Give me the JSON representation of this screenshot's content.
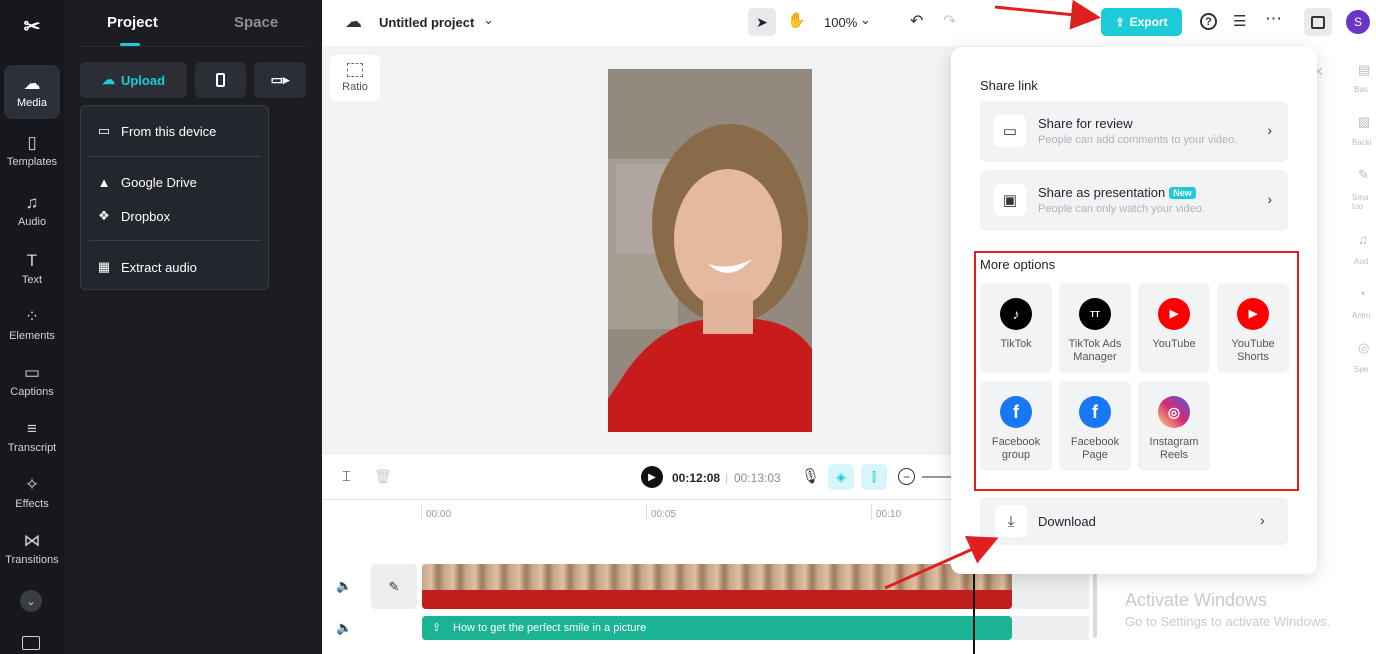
{
  "rail": {
    "items": [
      {
        "label": "Media",
        "icon": "cloud-upload-icon"
      },
      {
        "label": "Templates",
        "icon": "templates-icon"
      },
      {
        "label": "Audio",
        "icon": "music-note-icon"
      },
      {
        "label": "Text",
        "icon": "text-icon"
      },
      {
        "label": "Elements",
        "icon": "elements-icon"
      },
      {
        "label": "Captions",
        "icon": "captions-icon"
      },
      {
        "label": "Transcript",
        "icon": "transcript-icon"
      },
      {
        "label": "Effects",
        "icon": "effects-icon"
      },
      {
        "label": "Transitions",
        "icon": "transitions-icon"
      }
    ]
  },
  "panel": {
    "tabs": [
      "Project",
      "Space"
    ],
    "upload_label": "Upload",
    "menu": [
      "From this device",
      "Google Drive",
      "Dropbox",
      "Extract audio"
    ]
  },
  "topbar": {
    "project_name": "Untitled project",
    "zoom": "100%",
    "export_label": "Export",
    "avatar_letter": "S"
  },
  "canvas": {
    "ratio_label": "Ratio"
  },
  "player": {
    "current_time": "00:12:08",
    "total_time": "00:13:03"
  },
  "timeline": {
    "ticks": [
      "00:00",
      "00:05",
      "00:10"
    ],
    "audio_clip_label": "How to get the perfect smile in a picture"
  },
  "popup": {
    "share_title": "Share link",
    "share_review_title": "Share for review",
    "share_review_sub": "People can add comments to your video.",
    "share_presentation_title": "Share as presentation",
    "share_presentation_badge": "New",
    "share_presentation_sub": "People can only watch your video.",
    "more_title": "More options",
    "options": [
      {
        "label": "TikTok",
        "color": "#000000"
      },
      {
        "label": "TikTok Ads Manager",
        "color": "#000000"
      },
      {
        "label": "YouTube",
        "color": "#ff0000"
      },
      {
        "label": "YouTube Shorts",
        "color": "#ff0000"
      },
      {
        "label": "Facebook group",
        "color": "#1877f2"
      },
      {
        "label": "Facebook Page",
        "color": "#1877f2"
      },
      {
        "label": "Instagram Reels",
        "color": "#d62976"
      }
    ],
    "download_label": "Download"
  },
  "rightstrip": [
    "Bas",
    "Backi",
    "Sma too",
    "Aud",
    "Anim",
    "Spe"
  ],
  "watermark": {
    "line1": "Activate Windows",
    "line2": "Go to Settings to activate Windows."
  },
  "colors": {
    "accent": "#1ccad8",
    "annotation": "#e02020"
  }
}
